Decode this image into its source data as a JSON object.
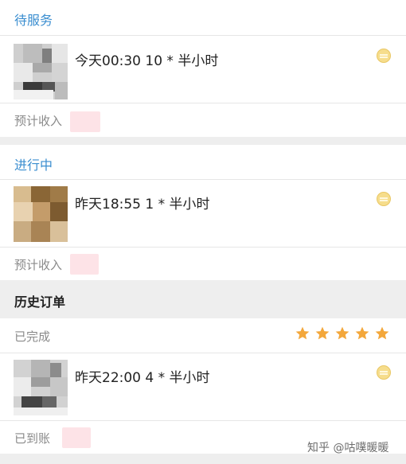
{
  "section_waiting": {
    "title": "待服务",
    "order": {
      "time_text": "今天00:30  10 * 半小时"
    },
    "income_label": "预计收入"
  },
  "section_inprogress": {
    "title": "进行中",
    "order": {
      "time_text": "昨天18:55  1 * 半小时"
    },
    "income_label": "预计收入"
  },
  "history": {
    "title": "历史订单",
    "status": "已完成",
    "rating": 5,
    "order": {
      "time_text": "昨天22:00  4 * 半小时"
    },
    "income_label": "已到账"
  },
  "watermark": "知乎 @咕噗暖暖",
  "colors": {
    "accent": "#3b8ed0",
    "star": "#f3a73b",
    "badge": "#f6dd8c"
  }
}
